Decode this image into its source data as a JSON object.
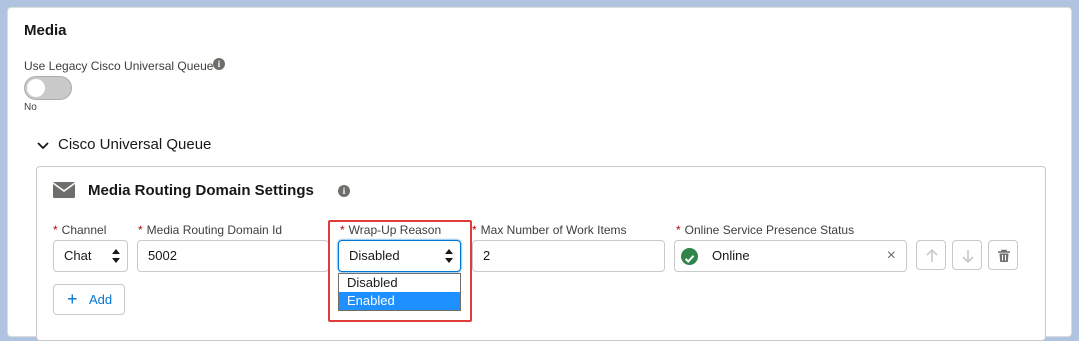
{
  "media": {
    "title": "Media",
    "legacy_label": "Use Legacy Cisco Universal Queue",
    "info_icon": "info-icon",
    "toggle_state": "No",
    "toggle_on": false
  },
  "queue": {
    "title": "Cisco Universal Queue",
    "expanded": true
  },
  "mrd": {
    "title": "Media Routing Domain Settings",
    "required_marker": "*",
    "fields": {
      "channel": {
        "label": "Channel",
        "value": "Chat"
      },
      "domain_id": {
        "label": "Media Routing Domain Id",
        "value": "5002"
      },
      "wrap_up": {
        "label": "Wrap-Up Reason",
        "value": "Disabled",
        "options": [
          "Disabled",
          "Enabled"
        ],
        "highlighted_option": "Enabled"
      },
      "max_items": {
        "label": "Max Number of Work Items",
        "value": "2"
      },
      "presence": {
        "label": "Online Service Presence Status",
        "value": "Online",
        "clear": "×"
      }
    },
    "add_label": "Add",
    "add_icon": "+"
  },
  "colors": {
    "required": "#ba0517",
    "accent": "#0176d3",
    "online": "#2e844a",
    "highlight_border": "#e03c3c",
    "selected_option": "#1e90ff"
  }
}
